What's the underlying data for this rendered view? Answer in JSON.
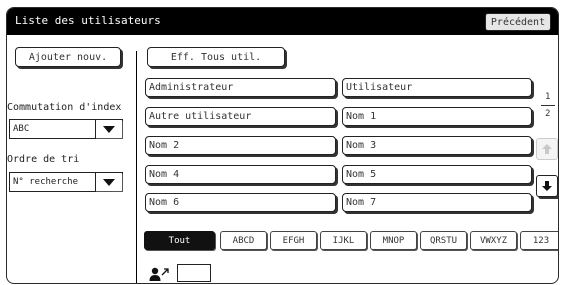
{
  "header": {
    "title": "Liste des utilisateurs",
    "prev_label": "Précédent"
  },
  "left_panel": {
    "add_label": "Ajouter nouv.",
    "index_label": "Commutation d'index",
    "index_value": "ABC",
    "sort_label": "Ordre de tri",
    "sort_value": "N° recherche"
  },
  "delete_all_label": "Eff. Tous util.",
  "users": [
    "Administrateur",
    "Utilisateur",
    "Autre utilisateur",
    "Nom 1",
    "Nom 2",
    "Nom 3",
    "Nom 4",
    "Nom 5",
    "Nom 6",
    "Nom 7"
  ],
  "pagination": {
    "current": "1",
    "total": "2"
  },
  "tabs": [
    "Tout",
    "ABCD",
    "EFGH",
    "IJKL",
    "MNOP",
    "QRSTU",
    "VWXYZ",
    "123"
  ],
  "active_tab": "Tout"
}
